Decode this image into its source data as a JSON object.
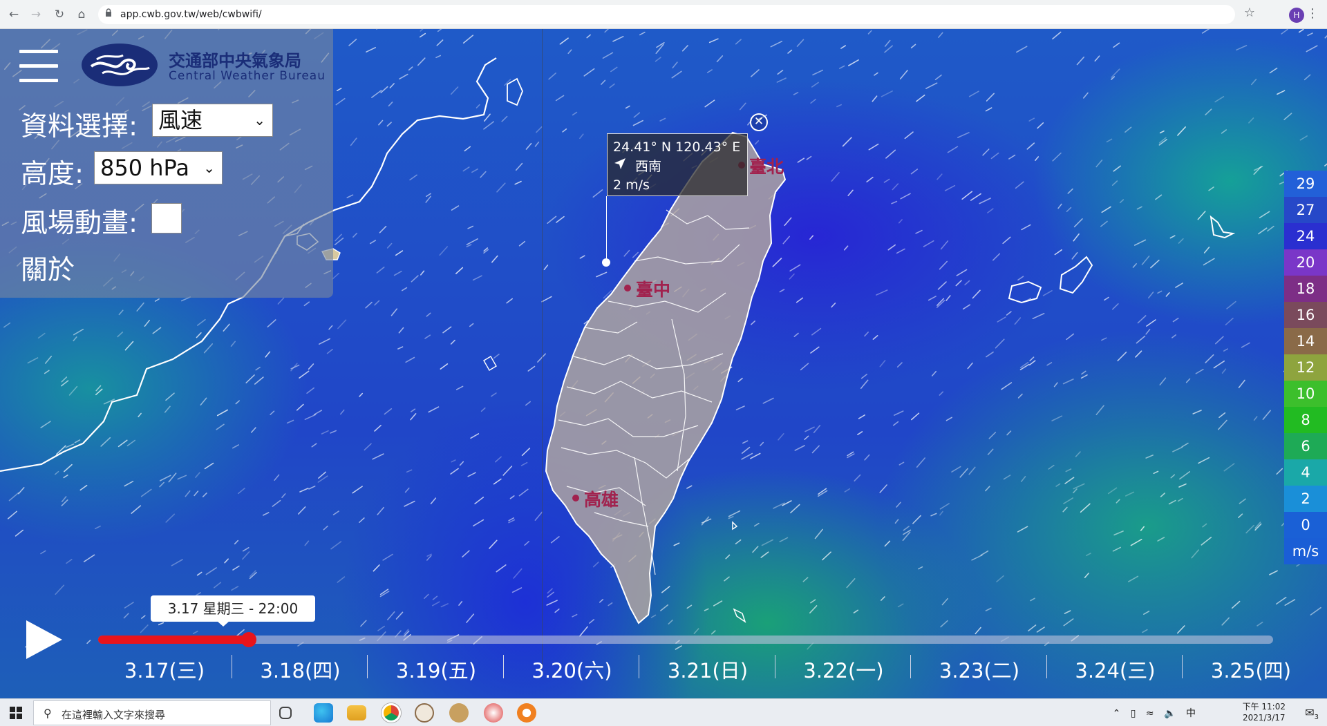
{
  "browser": {
    "url": "app.cwb.gov.tw/web/cwbwifi/",
    "avatar": "H",
    "icons": [
      "back-icon",
      "forward-icon",
      "reload-icon",
      "home-icon",
      "lock-icon",
      "star-icon",
      "kebab-icon"
    ]
  },
  "panel": {
    "agency_name": "交通部中央氣象局",
    "agency_name_en": "Central Weather Bureau",
    "data_label": "資料選擇:",
    "data_value": "風速",
    "height_label": "高度:",
    "height_value": "850 hPa",
    "anim_label": "風場動畫:",
    "about_label": "關於"
  },
  "popup": {
    "coords": "24.41° N  120.43° E",
    "direction": "西南",
    "speed": "2 m/s"
  },
  "cities": [
    {
      "name": "臺北"
    },
    {
      "name": "臺中"
    },
    {
      "name": "高雄"
    }
  ],
  "legend": {
    "values": [
      "29",
      "27",
      "24",
      "20",
      "18",
      "16",
      "14",
      "12",
      "10",
      "8",
      "6",
      "4",
      "2",
      "0"
    ],
    "colors": [
      "#2260d8",
      "#2648c8",
      "#2a2fd0",
      "#7a36c8",
      "#7d2e86",
      "#7a4a5c",
      "#8a6a48",
      "#8ea43e",
      "#3cbf2c",
      "#22bb22",
      "#1eaa56",
      "#1aa8a8",
      "#1a8fd8",
      "#1a60d6"
    ],
    "unit": "m/s"
  },
  "timeline": {
    "current_label": "3.17 星期三 - 22:00",
    "progress": 0.1,
    "days": [
      "3.17(三)",
      "3.18(四)",
      "3.19(五)",
      "3.20(六)",
      "3.21(日)",
      "3.22(一)",
      "3.23(二)",
      "3.24(三)",
      "3.25(四)"
    ]
  },
  "taskbar": {
    "search_placeholder": "在這裡輸入文字來搜尋",
    "ime": "中",
    "time": "下午 11:02",
    "date": "2021/3/17",
    "notif_count": "3"
  }
}
